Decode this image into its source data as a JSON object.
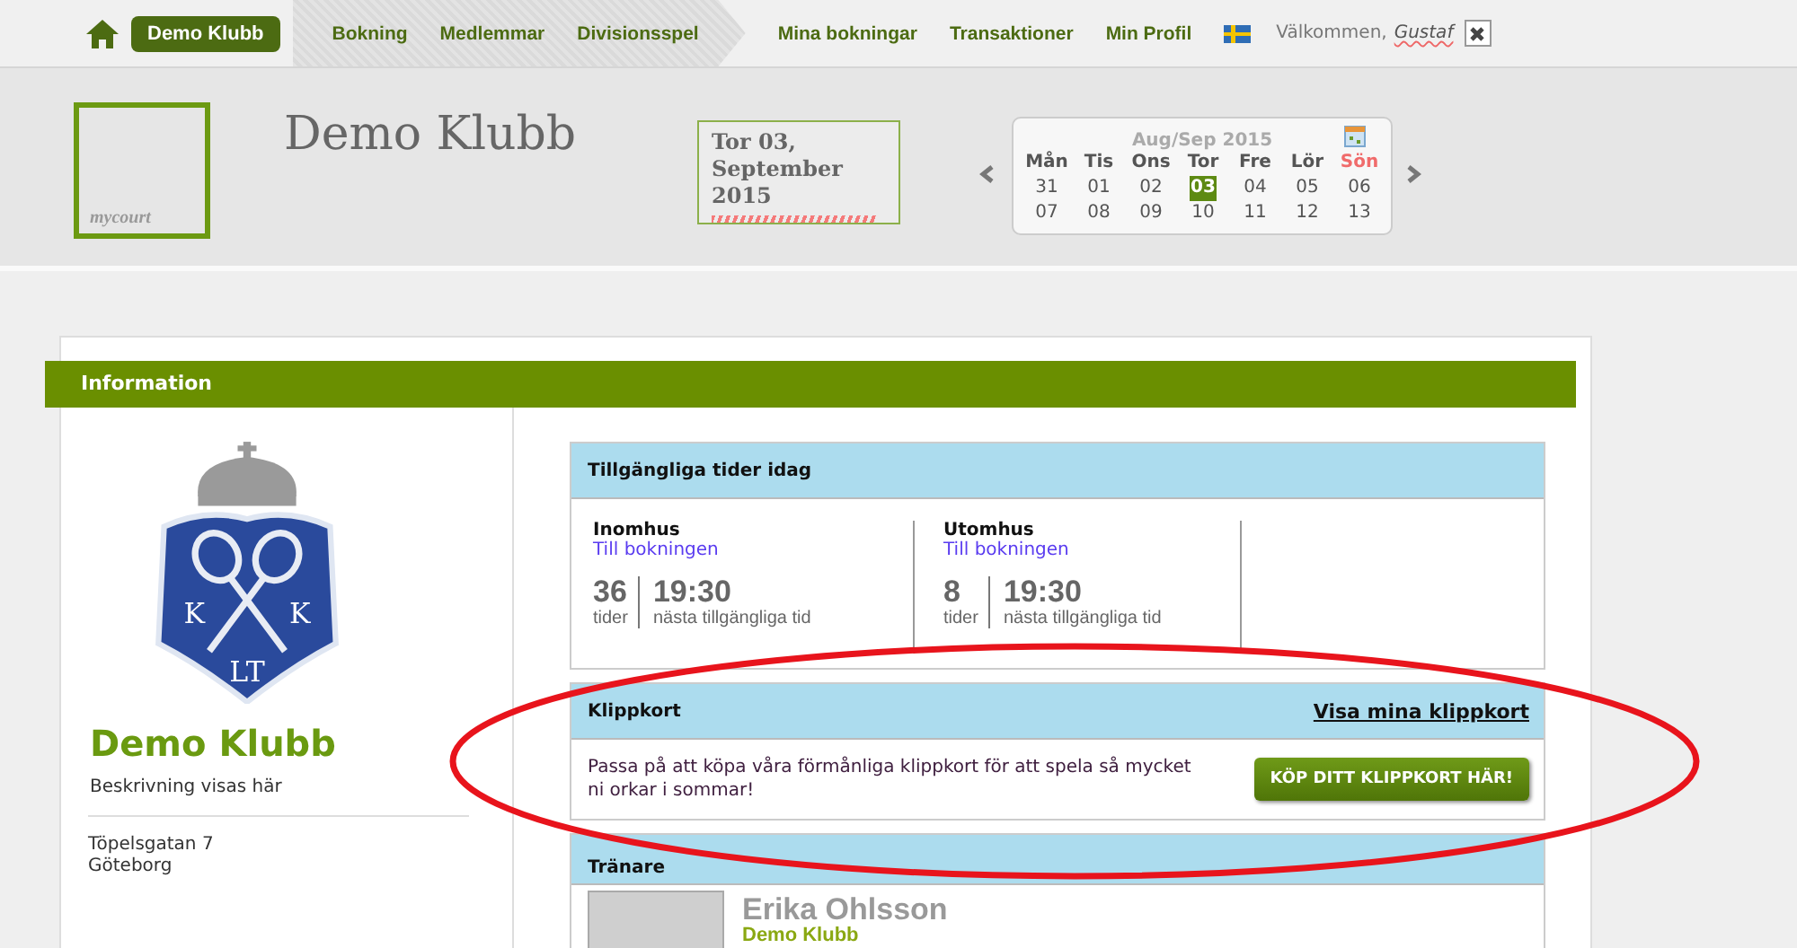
{
  "nav": {
    "club_button": "Demo Klubb",
    "group_items": [
      {
        "label": "Bokning"
      },
      {
        "label": "Medlemmar"
      },
      {
        "label": "Divisionsspel"
      }
    ],
    "items": [
      {
        "label": "Mina bokningar"
      },
      {
        "label": "Transaktioner"
      },
      {
        "label": "Min Profil"
      }
    ],
    "welcome": "Välkommen,",
    "user": "Gustaf"
  },
  "header": {
    "logo_text": "mycourt",
    "club_name": "Demo Klubb",
    "date_line1": "Tor 03,",
    "date_line2": "September 2015",
    "calendar": {
      "title": "Aug/Sep 2015",
      "weekdays": [
        {
          "label": "Mån",
          "weekend": false
        },
        {
          "label": "Tis",
          "weekend": false
        },
        {
          "label": "Ons",
          "weekend": false
        },
        {
          "label": "Tor",
          "weekend": false
        },
        {
          "label": "Fre",
          "weekend": false
        },
        {
          "label": "Lör",
          "weekend": false
        },
        {
          "label": "Sön",
          "weekend": true
        }
      ],
      "days": [
        {
          "label": "31",
          "selected": false
        },
        {
          "label": "01",
          "selected": false
        },
        {
          "label": "02",
          "selected": false
        },
        {
          "label": "03",
          "selected": true
        },
        {
          "label": "04",
          "selected": false
        },
        {
          "label": "05",
          "selected": false
        },
        {
          "label": "06",
          "selected": false
        },
        {
          "label": "07",
          "selected": false
        },
        {
          "label": "08",
          "selected": false
        },
        {
          "label": "09",
          "selected": false
        },
        {
          "label": "10",
          "selected": false
        },
        {
          "label": "11",
          "selected": false
        },
        {
          "label": "12",
          "selected": false
        },
        {
          "label": "13",
          "selected": false
        }
      ]
    }
  },
  "section_title": "Information",
  "club": {
    "crest_letters": [
      "K",
      "K",
      "LT"
    ],
    "name": "Demo Klubb",
    "description": "Beskrivning visas här",
    "address": [
      "Töpelsgatan 7",
      "Göteborg"
    ]
  },
  "available": {
    "title": "Tillgängliga tider idag",
    "columns": [
      {
        "title": "Inomhus",
        "link": "Till bokningen",
        "count": "36",
        "count_label": "tider",
        "time": "19:30",
        "time_label": "nästa tillgängliga tid"
      },
      {
        "title": "Utomhus",
        "link": "Till bokningen",
        "count": "8",
        "count_label": "tider",
        "time": "19:30",
        "time_label": "nästa tillgängliga tid"
      }
    ]
  },
  "punch_card": {
    "title": "Klippkort",
    "link": "Visa mina klippkort",
    "text": "Passa på att köpa våra förmånliga klippkort för att spela så mycket ni orkar i sommar!",
    "button": "KÖP DITT KLIPPKORT HÄR!"
  },
  "trainers": {
    "title": "Tränare",
    "items": [
      {
        "name": "Erika Ohlsson",
        "club": "Demo Klubb"
      }
    ]
  }
}
